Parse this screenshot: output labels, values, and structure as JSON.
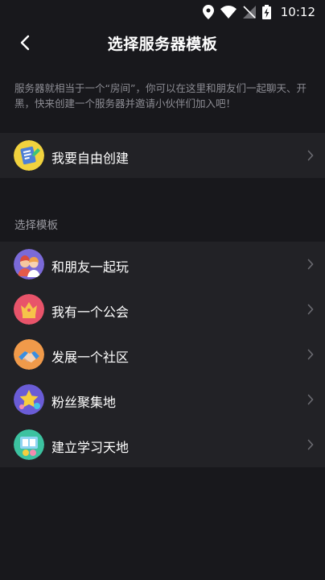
{
  "status_bar": {
    "time": "10:12"
  },
  "header": {
    "title": "选择服务器模板"
  },
  "description": "服务器就相当于一个“房间”，你可以在这里和朋友们一起聊天、开黑，快来创建一个服务器并邀请小伙伴们加入吧！",
  "custom_create": {
    "label": "我要自由创建"
  },
  "templates": {
    "section_title": "选择模板",
    "items": [
      {
        "label": "和朋友一起玩",
        "icon": "friends-icon"
      },
      {
        "label": "我有一个公会",
        "icon": "guild-icon"
      },
      {
        "label": "发展一个社区",
        "icon": "community-icon"
      },
      {
        "label": "粉丝聚集地",
        "icon": "star-icon"
      },
      {
        "label": "建立学习天地",
        "icon": "study-icon"
      }
    ]
  },
  "colors": {
    "background": "#18181c",
    "card": "#222226",
    "text_secondary": "#8c8c93"
  }
}
